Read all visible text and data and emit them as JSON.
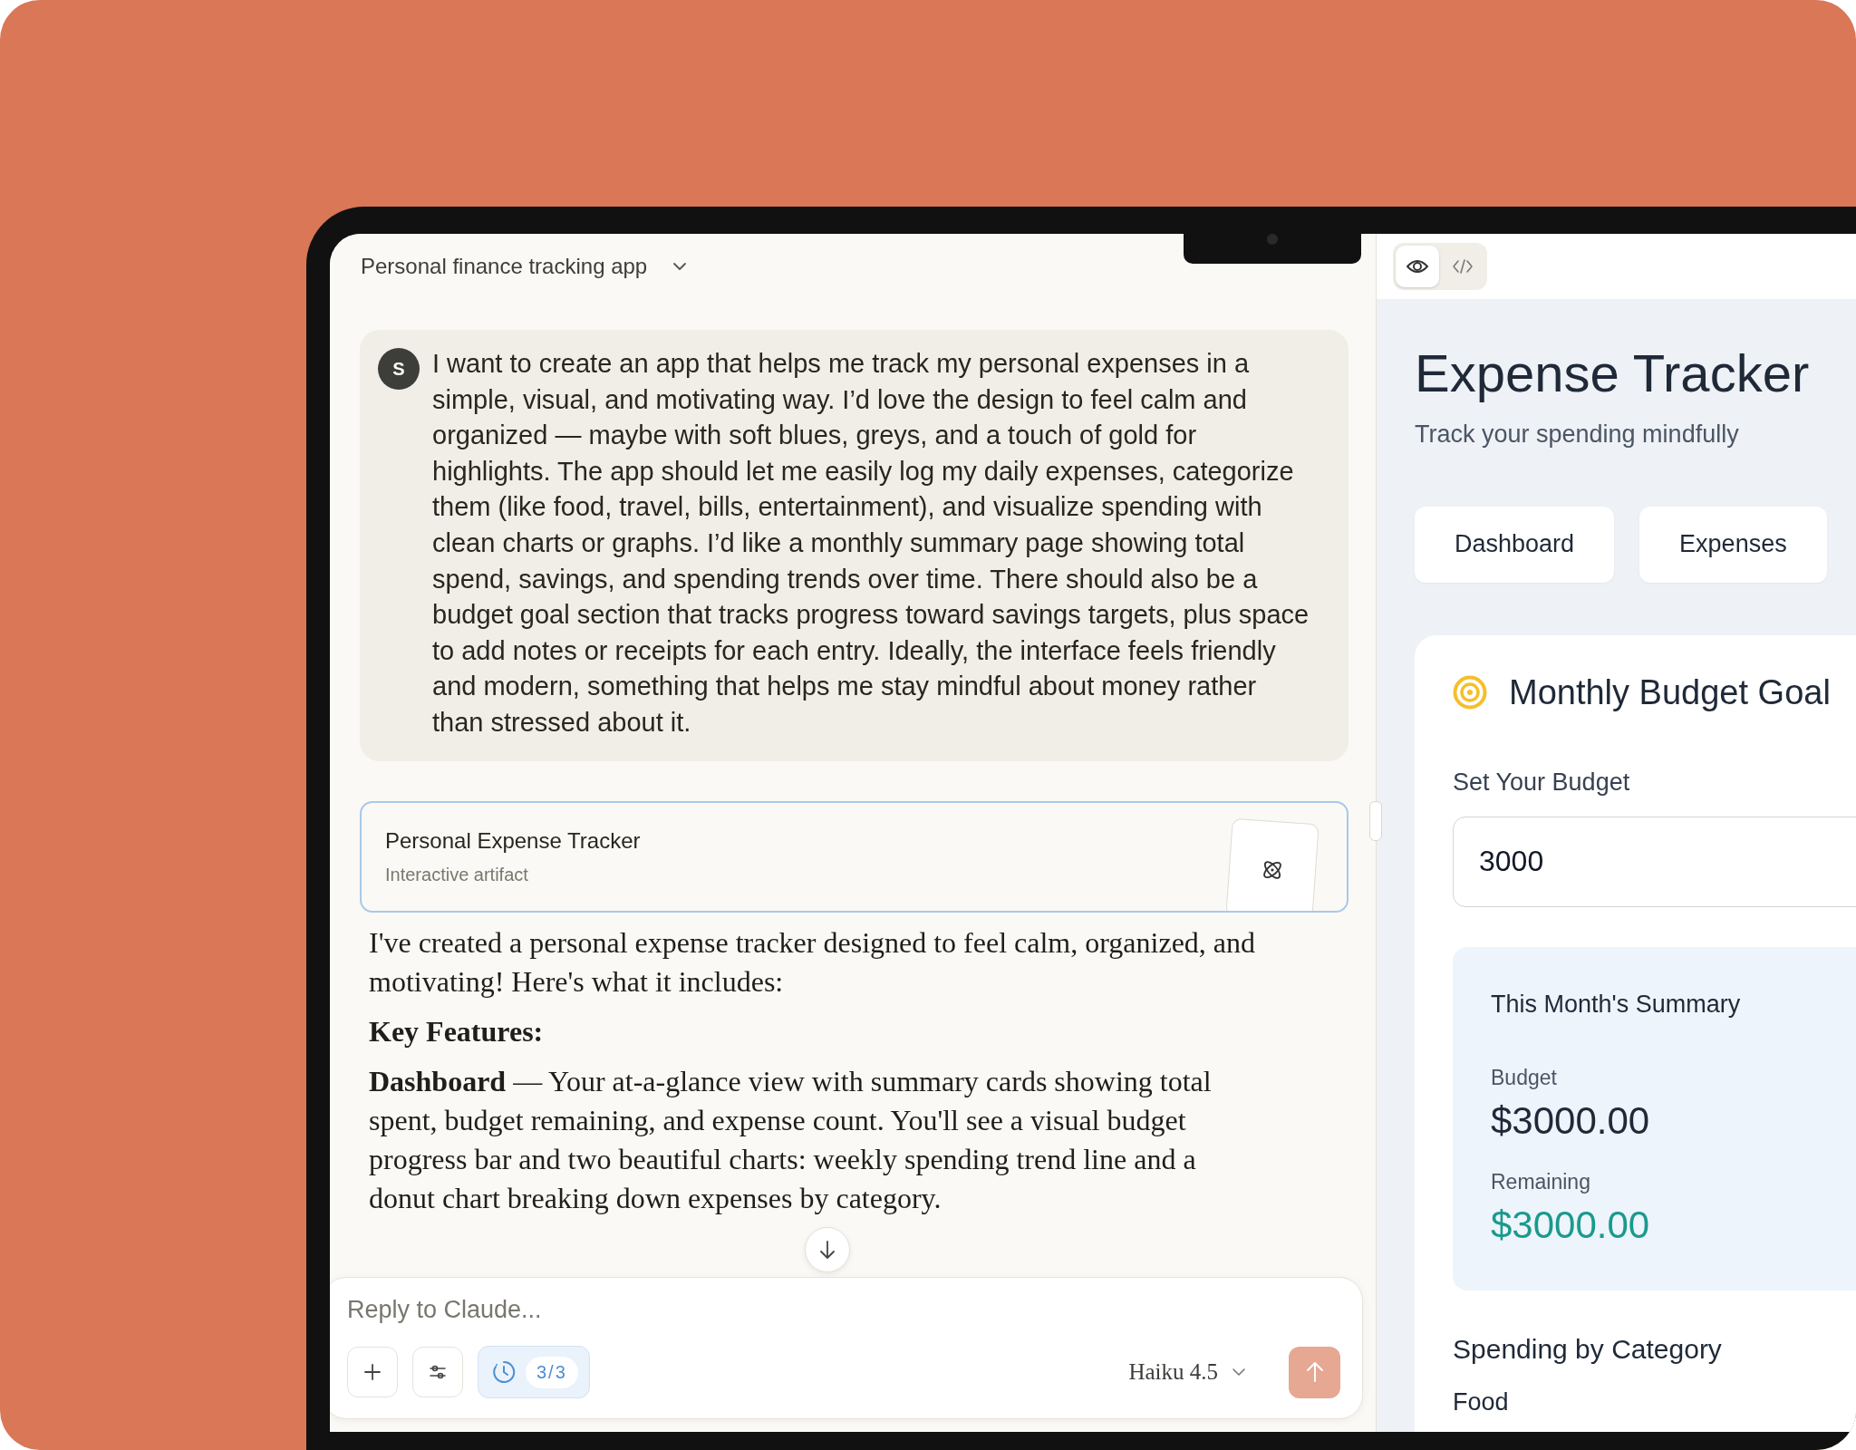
{
  "conversation": {
    "title": "Personal finance tracking app"
  },
  "user_message": {
    "avatar": "S",
    "text": "I want to create an app that helps me track my personal expenses in a simple, visual, and motivating way. I’d love the design to feel calm and organized — maybe with soft blues, greys, and a touch of gold for highlights. The app should let me easily log my daily expenses, categorize them (like food, travel, bills, entertainment), and visualize spending with clean charts or graphs. I’d like a monthly summary page showing total spend, savings, and spending trends over time. There should also be a budget goal section that tracks progress toward savings targets, plus space to add notes or receipts for each entry. Ideally, the interface feels friendly and modern, something that helps me stay mindful about money rather than stressed about it."
  },
  "artifact_card": {
    "title": "Personal Expense Tracker",
    "subtitle": "Interactive artifact"
  },
  "response": [
    {
      "kind": "paragraph",
      "text": "I've created a personal expense tracker designed to feel calm, organized, and motivating! Here's what it includes:"
    },
    {
      "kind": "heading",
      "text": "Key Features:"
    },
    {
      "kind": "paragraph",
      "text": "**Dashboard** — Your at-a-glance view with summary cards showing total spent, budget remaining, and expense count. You'll see a visual budget progress bar and two beautiful charts: weekly spending trend line and a donut chart breaking down expenses by category."
    }
  ],
  "composer": {
    "placeholder": "Reply to Claude...",
    "counter": "3/3",
    "model": "Haiku 4.5"
  },
  "preview": {
    "views": [
      {
        "kind": "preview",
        "selected": true
      },
      {
        "kind": "code",
        "selected": false
      }
    ],
    "title": "Expense Tracker",
    "subtitle": "Track your spending mindfully",
    "tabs": [
      {
        "label": "Dashboard"
      },
      {
        "label": "Expenses"
      }
    ],
    "budget_card": {
      "title": "Monthly Budget Goal",
      "field_label": "Set Your Budget",
      "field_value": "3000",
      "summary": {
        "title": "This Month's Summary",
        "items": [
          {
            "kind": "neutral",
            "label": "Budget",
            "value": "$3000.00"
          },
          {
            "kind": "positive",
            "label": "Remaining",
            "value": "$3000.00"
          }
        ]
      },
      "section_title": "Spending by Category",
      "categories": [
        "Food"
      ]
    }
  }
}
